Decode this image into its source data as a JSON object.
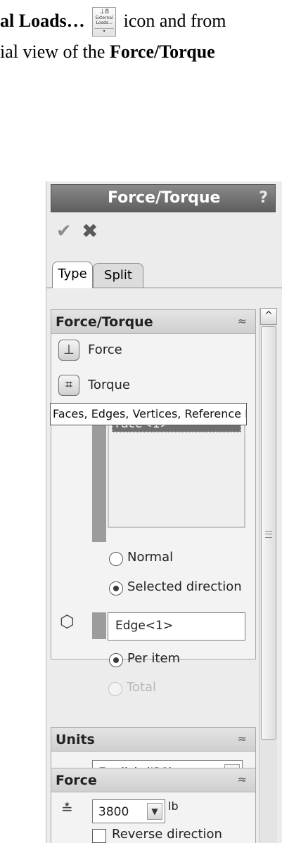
{
  "document": {
    "line1_bold": "al Loads…",
    "line1_after": " icon and from",
    "line2_before": "ial view of the ",
    "line2_bold": "Force/Torque",
    "toolbar_icon": {
      "glyph": "⊥8",
      "label_1": "External",
      "label_2": "Loads...",
      "drop": "▾"
    }
  },
  "panel": {
    "title": "Force/Torque",
    "help": "?",
    "ok_glyph": "✔",
    "cancel_glyph": "✖",
    "tabs": [
      {
        "label": "Type",
        "active": true
      },
      {
        "label": "Split",
        "active": false
      }
    ],
    "scroll_up_glyph": "^",
    "groups": {
      "force_torque": {
        "title": "Force/Torque",
        "collapse_glyph": "≈",
        "options": [
          {
            "label": "Force",
            "icon": "force-icon",
            "glyph": "⊥"
          },
          {
            "label": "Torque",
            "icon": "torque-icon",
            "glyph": "⌗"
          }
        ],
        "faces_list": {
          "icon_glyph": "⬡",
          "selected_item": "Face<1>"
        },
        "tooltip": "Faces, Edges, Vertices, Reference Po",
        "direction_options": [
          {
            "label": "Normal",
            "checked": false
          },
          {
            "label": "Selected direction",
            "checked": true
          }
        ],
        "direction_ref": {
          "icon_glyph": "⬡",
          "value": "Edge<1>"
        },
        "distribution_options": [
          {
            "label": "Per item",
            "checked": true,
            "disabled": false
          },
          {
            "label": "Total",
            "checked": false,
            "disabled": true
          }
        ]
      },
      "units": {
        "title": "Units",
        "collapse_glyph": "≈",
        "icon_glyph": "▤",
        "value": "English (IPS)",
        "arrow_glyph": "▼"
      },
      "force": {
        "title": "Force",
        "collapse_glyph": "≈",
        "icon_glyph": "≛",
        "value": "3800",
        "arrow_glyph": "▼",
        "unit": "lb",
        "reverse_label": "Reverse direction"
      }
    }
  }
}
